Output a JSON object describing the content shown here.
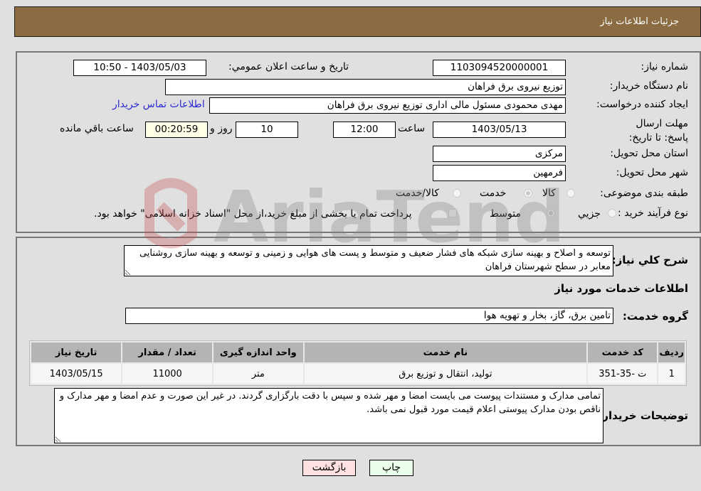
{
  "header": {
    "title": "جزئیات اطلاعات نیاز"
  },
  "fields": {
    "need_number_label": "شماره نیاز:",
    "need_number": "1103094520000001",
    "announce_label": "تاریخ و ساعت اعلان عمومي:",
    "announce_value": "1403/05/03 - 10:50",
    "buyer_org_label": "نام دستگاه خریدار:",
    "buyer_org": "توزیع نیروی برق فراهان",
    "creator_label": "ایجاد کننده درخواست:",
    "creator": "مهدی  محمودی مسئول مالی اداری توزیع نیروی برق فراهان",
    "contact_link": "اطلاعات تماس خریدار",
    "deadline_label": "مهلت ارسال پاسخ: تا تاریخ:",
    "deadline_date": "1403/05/13",
    "time_label": "ساعت",
    "deadline_time": "12:00",
    "days": "10",
    "days_label": "روز و",
    "remaining": "00:20:59",
    "remaining_label": "ساعت باقي مانده",
    "province_label": "استان محل تحویل:",
    "province": "مرکزی",
    "city_label": "شهر محل تحویل:",
    "city": "فرمهین",
    "category_label": "طبقه بندی موضوعی:",
    "category_options": [
      {
        "label": "کالا",
        "selected": false
      },
      {
        "label": "خدمت",
        "selected": true
      },
      {
        "label": "کالا/خدمت",
        "selected": false
      }
    ],
    "process_label": "نوع فرآیند خرید :",
    "process_options": [
      {
        "label": "جزيي",
        "selected": false
      },
      {
        "label": "متوسط",
        "selected": true
      }
    ],
    "treasury_note": "پرداخت تمام یا بخشی از مبلغ خرید،از محل \"اسناد خزانه اسلامی\" خواهد بود.",
    "treasury_checked": false
  },
  "description": {
    "label": "شرح کلي نياز:",
    "text": "توسعه و اصلاح و بهینه سازی شبکه های فشار ضعیف و متوسط و پست های هوایی و زمینی و توسعه و بهینه سازی روشنایی معابر در سطح شهرستان فراهان"
  },
  "services": {
    "section_title": "اطلاعات خدمات مورد نیاز",
    "group_label": "گروه خدمت:",
    "group_value": "تامین برق، گاز، بخار و تهویه هوا",
    "columns": [
      "ردیف",
      "کد خدمت",
      "نام خدمت",
      "واحد اندازه گیری",
      "تعداد / مقدار",
      "تاریخ نیاز"
    ],
    "rows": [
      [
        "1",
        "ت -35-351",
        "تولید، انتقال و توزیع برق",
        "متر",
        "11000",
        "1403/05/15"
      ]
    ]
  },
  "buyer_notes": {
    "label": "توضیحات خریدار:",
    "text": "تمامی مدارک و مستندات پیوست می بایست امضا و مهر شده و سپس با دقت بارگزاری گردند. در غیر این صورت و عدم امضا و مهر مدارک و ناقص بودن مدارک پیوستی اعلام قیمت مورد قبول نمی باشد."
  },
  "buttons": {
    "print": "چاپ",
    "back": "بازگشت"
  },
  "watermark": "AriaTender.neT",
  "colors": {
    "header_bg": "#8b6b41",
    "print_bg": "#eaffea",
    "back_bg": "#ffe0e0",
    "link": "#2b2bd6"
  }
}
